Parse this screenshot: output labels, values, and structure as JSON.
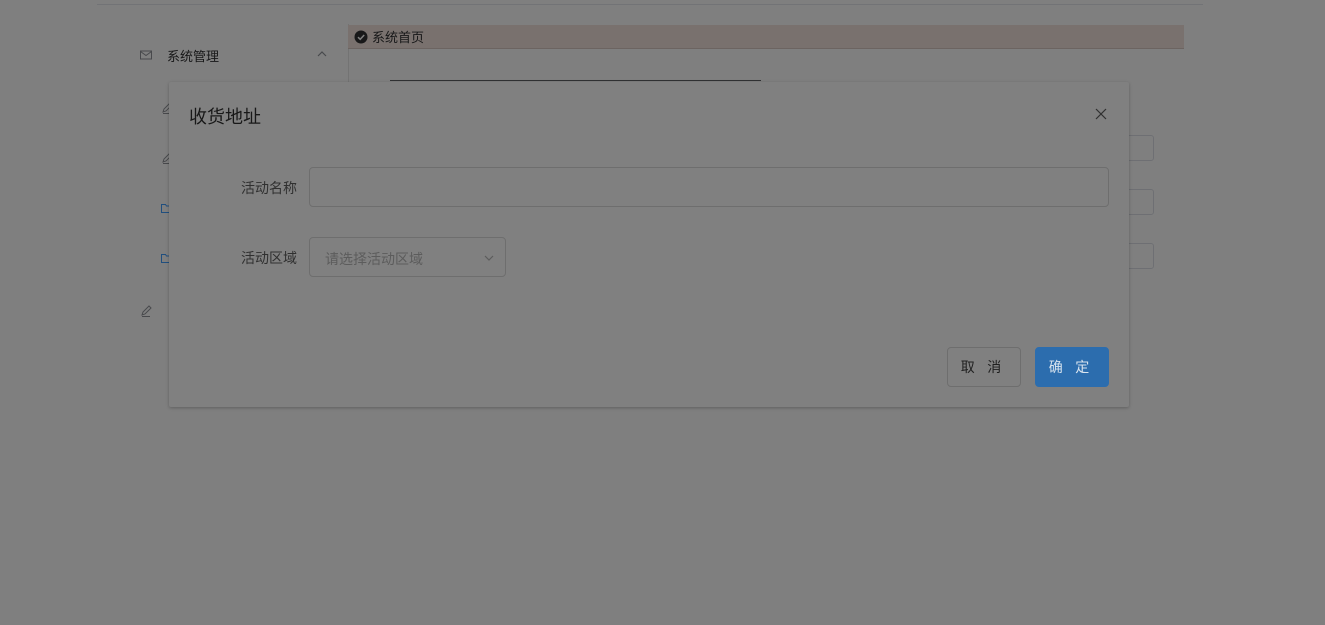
{
  "app": {
    "sidebar": {
      "title": "系统管理",
      "menu_icon": "mail-icon",
      "collapse_icon": "chevron-up-icon",
      "sub_icons": [
        "edit-icon",
        "edit-icon",
        "folder-icon",
        "folder-icon",
        "edit-icon"
      ]
    },
    "tabs": [
      {
        "label": "系统首页",
        "icon": "check-circle-icon"
      }
    ]
  },
  "dialog": {
    "title": "收货地址",
    "close_icon": "close-icon",
    "fields": {
      "name": {
        "label": "活动名称",
        "value": "",
        "placeholder": ""
      },
      "region": {
        "label": "活动区域",
        "placeholder": "请选择活动区域",
        "icon": "chevron-down-icon"
      }
    },
    "buttons": {
      "cancel": "取 消",
      "confirm": "确 定"
    }
  },
  "colors": {
    "primary": "#409eff",
    "tab_bar": "#f2e3dc",
    "overlay": "rgba(0,0,0,0.5)"
  }
}
